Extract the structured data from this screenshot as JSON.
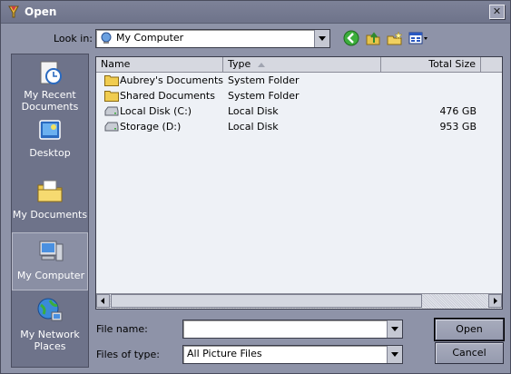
{
  "window": {
    "title": "Open",
    "close_glyph": "✕"
  },
  "lookin": {
    "label": "Look in:",
    "value": "My Computer"
  },
  "toolbar": {
    "icons": [
      "back-icon",
      "up-folder-icon",
      "new-folder-icon",
      "view-menu-icon"
    ]
  },
  "places": [
    {
      "label": "My Recent Documents",
      "icon": "recent-documents-icon"
    },
    {
      "label": "Desktop",
      "icon": "desktop-icon"
    },
    {
      "label": "My Documents",
      "icon": "my-documents-icon"
    },
    {
      "label": "My Computer",
      "icon": "my-computer-icon",
      "selected": true
    },
    {
      "label": "My Network Places",
      "icon": "network-places-icon"
    }
  ],
  "filelist": {
    "columns": [
      "Name",
      "Type",
      "Total Size"
    ],
    "rows": [
      {
        "name": "Aubrey's Documents",
        "type": "System Folder",
        "size": "",
        "icon": "folder-icon"
      },
      {
        "name": "Shared Documents",
        "type": "System Folder",
        "size": "",
        "icon": "folder-icon"
      },
      {
        "name": "Local Disk (C:)",
        "type": "Local Disk",
        "size": "476 GB",
        "icon": "drive-icon"
      },
      {
        "name": "Storage (D:)",
        "type": "Local Disk",
        "size": "953 GB",
        "icon": "drive-icon"
      }
    ]
  },
  "filename": {
    "label": "File name:",
    "value": ""
  },
  "filetype": {
    "label": "Files of type:",
    "value": "All Picture Files"
  },
  "buttons": {
    "open": "Open",
    "cancel": "Cancel"
  },
  "colors": {
    "frame": "#8e93a8",
    "places_bar": "#6e738a",
    "list_bg": "#eef1f6"
  }
}
